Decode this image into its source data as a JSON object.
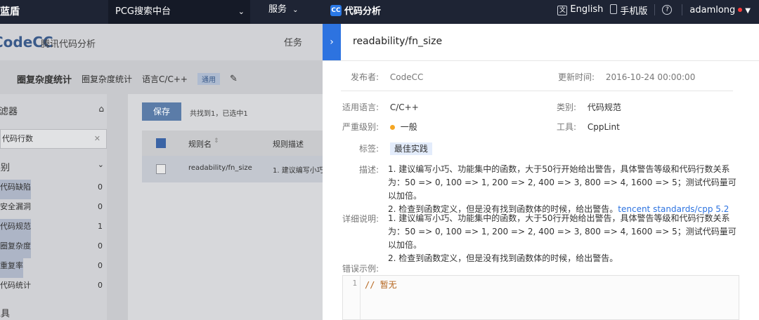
{
  "topbar": {
    "brand": "蓝盾",
    "project": "PCG搜索中台",
    "service": "服务",
    "app_name": "代码分析",
    "app_icon": "CC",
    "language": "English",
    "mobile": "手机版",
    "user": "adamlong"
  },
  "background": {
    "logo": "CodeCC",
    "logo_sub": "腾讯代码分析",
    "task": "任务",
    "crumb_title": "圈复杂度统计",
    "crumb_item": "圈复杂度统计",
    "crumb_lang": "语言C/C++",
    "crumb_tag": "通用",
    "sidebar_title": "过滤器",
    "search_value": "代码行数",
    "group_label": "类别",
    "sidebar_items": [
      {
        "label": "代码缺陷",
        "count": "0"
      },
      {
        "label": "安全漏洞",
        "count": "0"
      },
      {
        "label": "代码规范",
        "count": "1"
      },
      {
        "label": "圈复杂度",
        "count": "0"
      },
      {
        "label": "重复率",
        "count": "0"
      },
      {
        "label": "代码统计",
        "count": "0"
      }
    ],
    "bottom_group": "工具",
    "save": "保存",
    "found": "共找到1，已选中1",
    "col_name": "规则名",
    "col_desc": "规则描述",
    "row_name": "readability/fn_size",
    "row_desc": "1. 建议编写小巧"
  },
  "drawer": {
    "title": "readability/fn_size",
    "publisher_label": "发布者:",
    "publisher": "CodeCC",
    "updated_label": "更新时间:",
    "updated": "2016-10-24 00:00:00",
    "lang_label": "适用语言:",
    "lang": "C/C++",
    "category_label": "类别:",
    "category": "代码规范",
    "severity_label": "严重级别:",
    "severity": "一般",
    "tool_label": "工具:",
    "tool": "CppLint",
    "tags_label": "标签:",
    "tag": "最佳实践",
    "desc_label": "描述:",
    "desc_l1": "1. 建议编写小巧、功能集中的函数，大于50行开始给出警告，具体警告等级和代码行数关系",
    "desc_l2": "为：50 => 0, 100 => 1, 200 => 2, 400 => 3, 800 => 4, 1600 => 5；测试代码量可以加倍。",
    "desc_l3": "2. 检查到函数定义，但是没有找到函数体的时候，给出警告。",
    "desc_link": "tencent standards/cpp 5.2",
    "detail_label": "详细说明:",
    "detail_l1": "1. 建议编写小巧、功能集中的函数，大于50行开始给出警告，具体警告等级和代码行数关系",
    "detail_l2": "为：50 => 0, 100 => 1, 200 => 2, 400 => 3, 800 => 4, 1600 => 5；测试代码量可以加倍。",
    "detail_l3": "2. 检查到函数定义，但是没有找到函数体的时候，给出警告。",
    "example_label": "错误示例:",
    "code_line_no": "1",
    "code_line": "// 暂无"
  }
}
